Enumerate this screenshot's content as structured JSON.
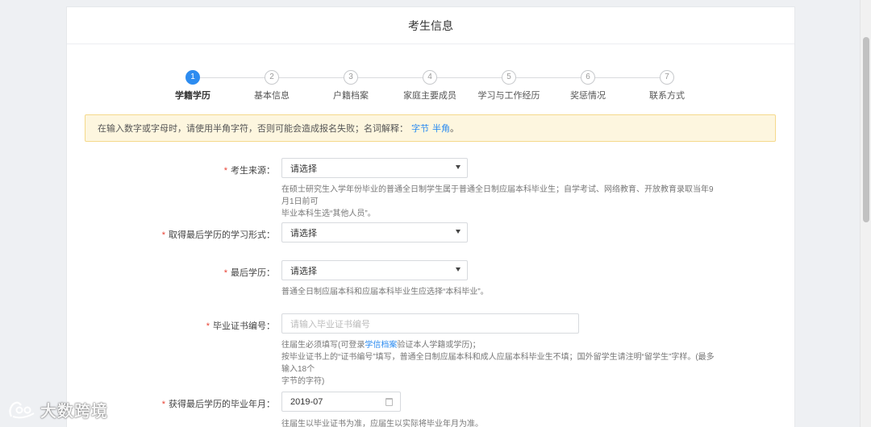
{
  "header": {
    "title": "考生信息"
  },
  "steps": [
    {
      "num": "1",
      "label": "学籍学历",
      "active": true
    },
    {
      "num": "2",
      "label": "基本信息",
      "active": false
    },
    {
      "num": "3",
      "label": "户籍档案",
      "active": false
    },
    {
      "num": "4",
      "label": "家庭主要成员",
      "active": false
    },
    {
      "num": "5",
      "label": "学习与工作经历",
      "active": false
    },
    {
      "num": "6",
      "label": "奖惩情况",
      "active": false
    },
    {
      "num": "7",
      "label": "联系方式",
      "active": false
    }
  ],
  "notice": {
    "text": "在输入数字或字母时，请使用半角字符，否则可能会造成报名失败；名词解释：",
    "link1": "字节",
    "link2": "半角",
    "end": "。"
  },
  "form": {
    "required_mark": "*",
    "source": {
      "label": "考生来源：",
      "value": "请选择",
      "help1": "在硕士研究生入学年份毕业的普通全日制学生属于普通全日制应届本科毕业生；自学考试、网络教育、开放教育录取当年9月1日前可",
      "help2": "毕业本科生选“其他人员”。"
    },
    "study_form": {
      "label": "取得最后学历的学习形式：",
      "value": "请选择"
    },
    "last_degree": {
      "label": "最后学历：",
      "value": "请选择",
      "help": "普通全日制应届本科和应届本科毕业生应选择“本科毕业”。"
    },
    "cert_no": {
      "label": "毕业证书编号：",
      "placeholder": "请输入毕业证书编号",
      "help1_pre": "往届生必须填写(可登录",
      "help1_link": "学信档案",
      "help1_post": "验证本人学籍或学历)；",
      "help2": "按毕业证书上的“证书编号”填写，普通全日制应届本科和成人应届本科毕业生不填；国外留学生请注明“留学生”字样。(最多输入18个",
      "help3": "字节的字符)"
    },
    "grad_date": {
      "label": "获得最后学历的毕业年月：",
      "value": "2019-07",
      "help": "往届生以毕业证书为准，应届生以实际将毕业年月为准。"
    }
  },
  "watermark": {
    "text": "大数跨境"
  }
}
